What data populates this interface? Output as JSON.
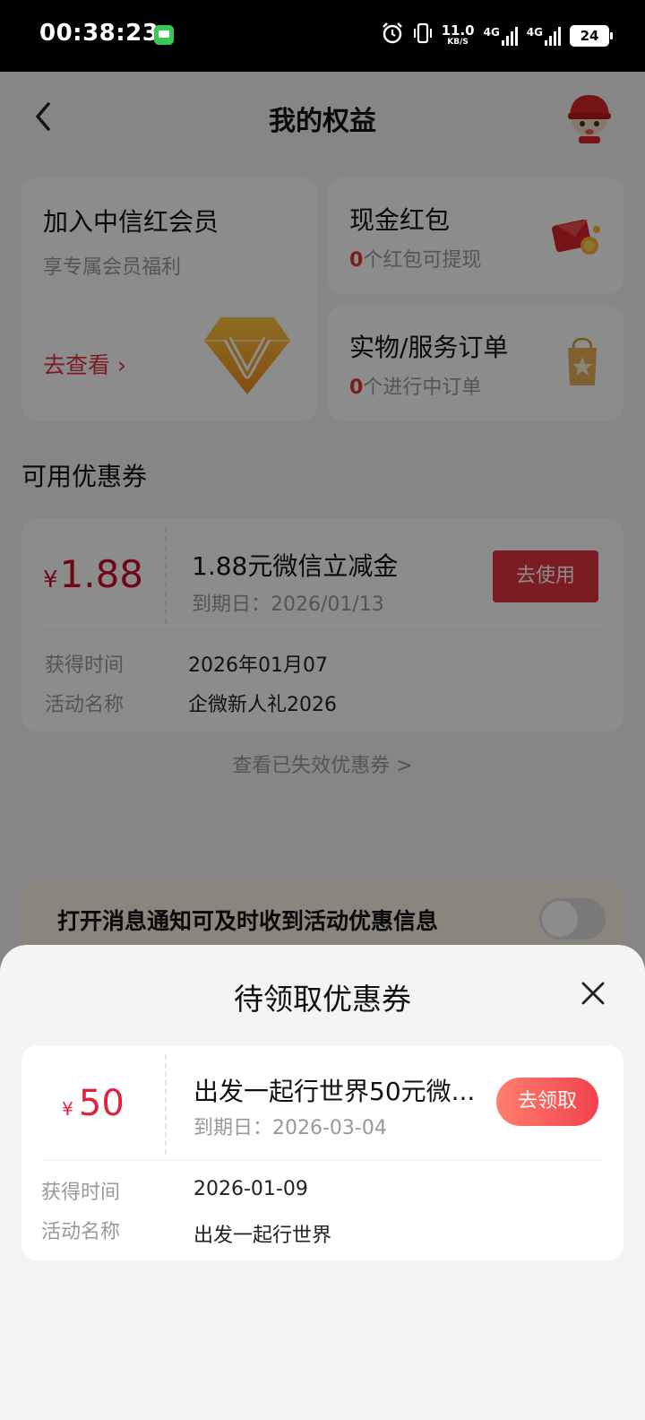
{
  "status_bar": {
    "time": "00:38:23",
    "net_speed_value": "11.0",
    "net_speed_unit": "KB/S",
    "signal1_label": "4G",
    "signal2_label": "4G",
    "battery": "24"
  },
  "header": {
    "title": "我的权益"
  },
  "vip_card": {
    "title": "加入中信红会员",
    "subtitle": "享专属会员福利",
    "link": "去查看 ›"
  },
  "cash_card": {
    "title": "现金红包",
    "count": "0",
    "suffix": "个红包可提现"
  },
  "order_card": {
    "title": "实物/服务订单",
    "count": "0",
    "suffix": "个进行中订单"
  },
  "available_section": {
    "title": "可用优惠券"
  },
  "coupon": {
    "currency": "¥",
    "amount": "1.88",
    "name": "1.88元微信立减金",
    "expiry": "到期日：2026/01/13",
    "button": "去使用",
    "obtained_label": "获得时间",
    "obtained_value": "2026年01月07",
    "activity_label": "活动名称",
    "activity_value": "企微新人礼2026"
  },
  "expired_link": "查看已失效优惠券 >",
  "notify": {
    "text": "打开消息通知可及时收到活动优惠信息"
  },
  "sheet": {
    "title": "待领取优惠券",
    "coupon": {
      "currency": "¥",
      "amount": "50",
      "name": "出发一起行世界50元微...",
      "expiry": "到期日：2026-03-04",
      "button": "去领取",
      "obtained_label": "获得时间",
      "obtained_value": "2026-01-09",
      "activity_label": "活动名称",
      "activity_value": "出发一起行世界"
    }
  },
  "colors": {
    "accent_red": "#e0323f",
    "sheet_button_gradient_start": "#ff7f6e",
    "sheet_button_gradient_end": "#f2414d",
    "notify_bg": "#fbf2e4"
  }
}
